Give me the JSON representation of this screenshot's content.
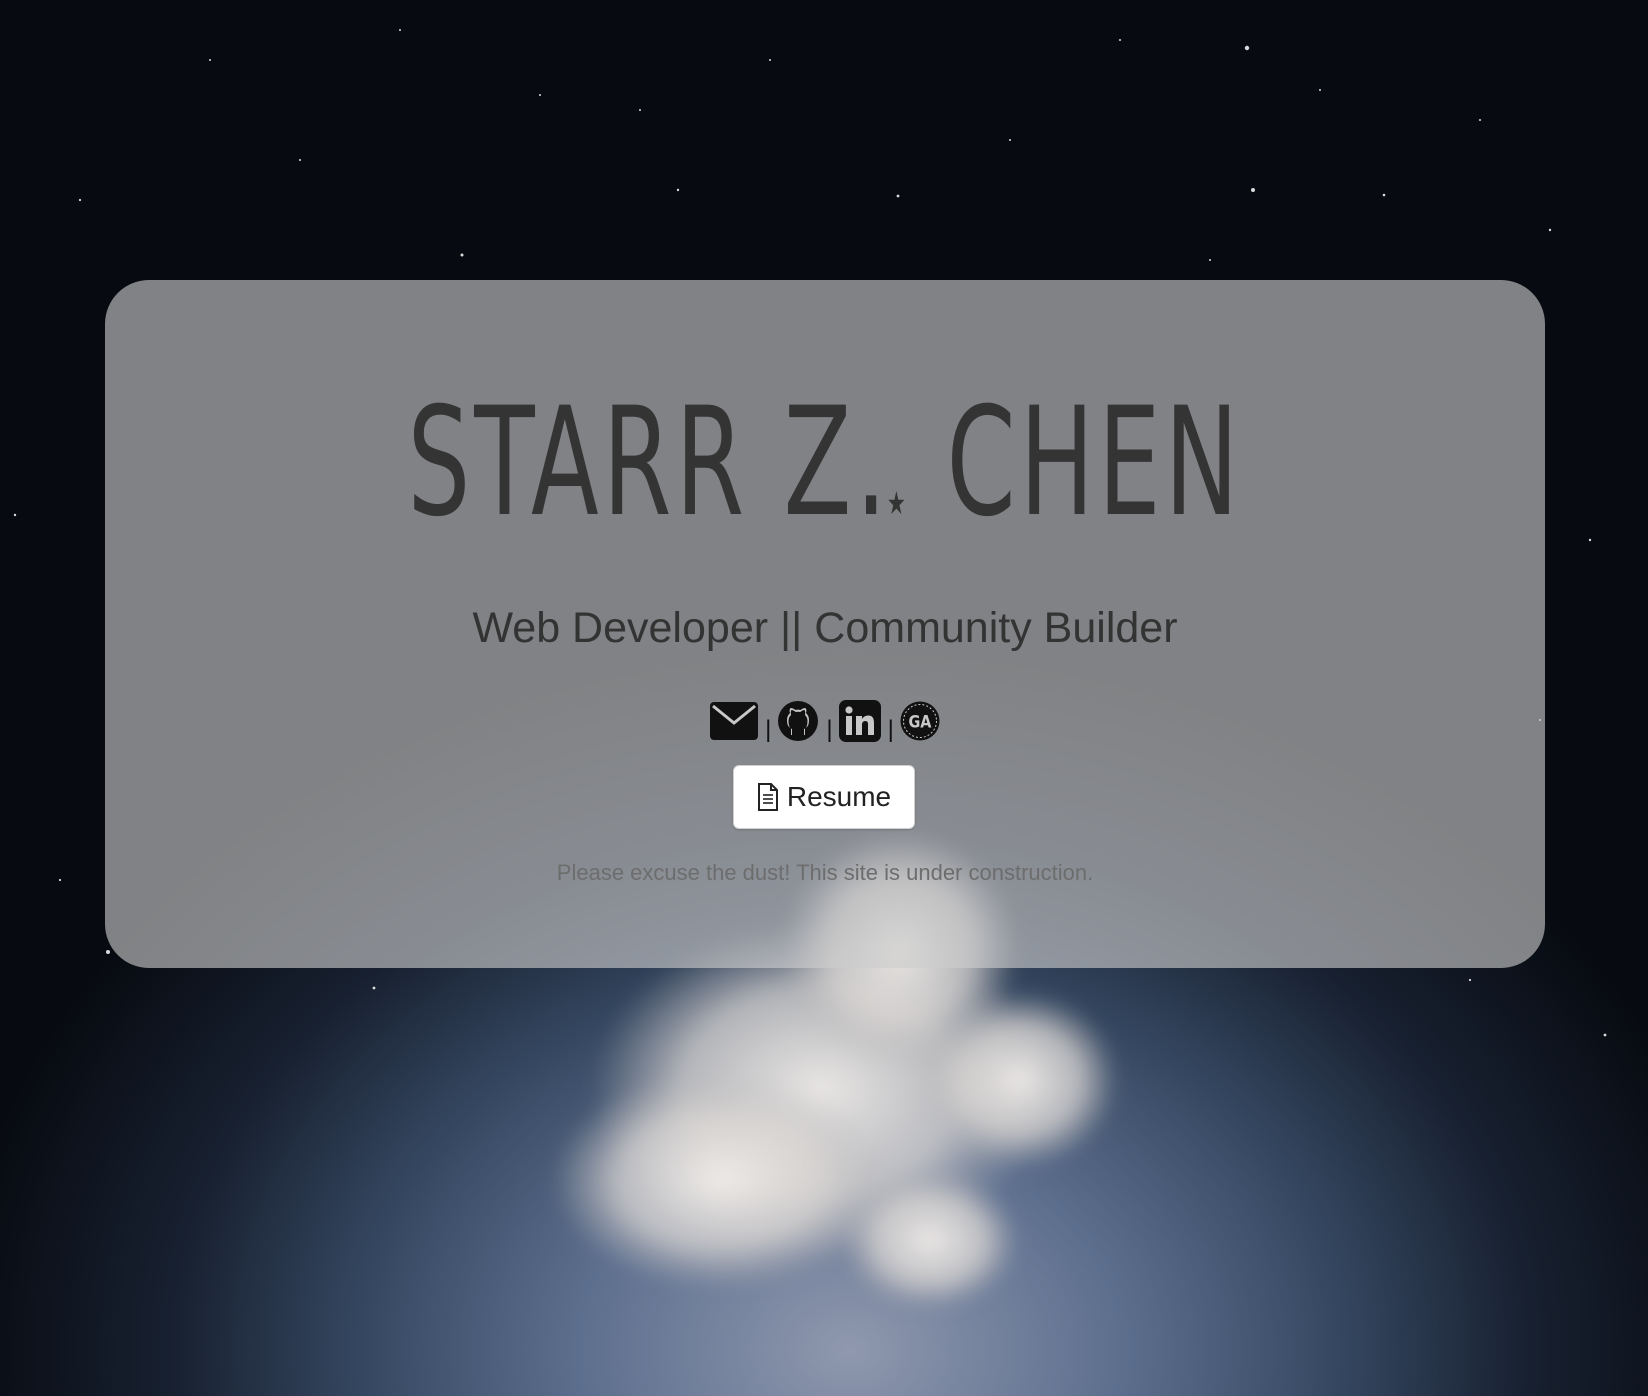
{
  "hero": {
    "name_text": "STARR Z",
    "name_dot": ".",
    "name_star": "★",
    "name_last": " CHEN",
    "subtitle": "Web Developer || Community Builder"
  },
  "social": {
    "separator": "|",
    "links": [
      {
        "name": "email",
        "icon": "envelope-icon"
      },
      {
        "name": "github",
        "icon": "github-icon"
      },
      {
        "name": "linkedin",
        "icon": "linkedin-icon",
        "glyph": "in"
      },
      {
        "name": "general-assembly",
        "icon": "general-assembly-icon",
        "glyph": "GA"
      }
    ]
  },
  "resume": {
    "label": "Resume",
    "icon": "document-icon"
  },
  "notice": "Please excuse the dust! This site is under construction.",
  "colors": {
    "card_bg": "#cdcdcd",
    "text_dark": "#343434",
    "notice": "#6d6d6d",
    "icon": "#111111",
    "button_bg": "#ffffff"
  }
}
